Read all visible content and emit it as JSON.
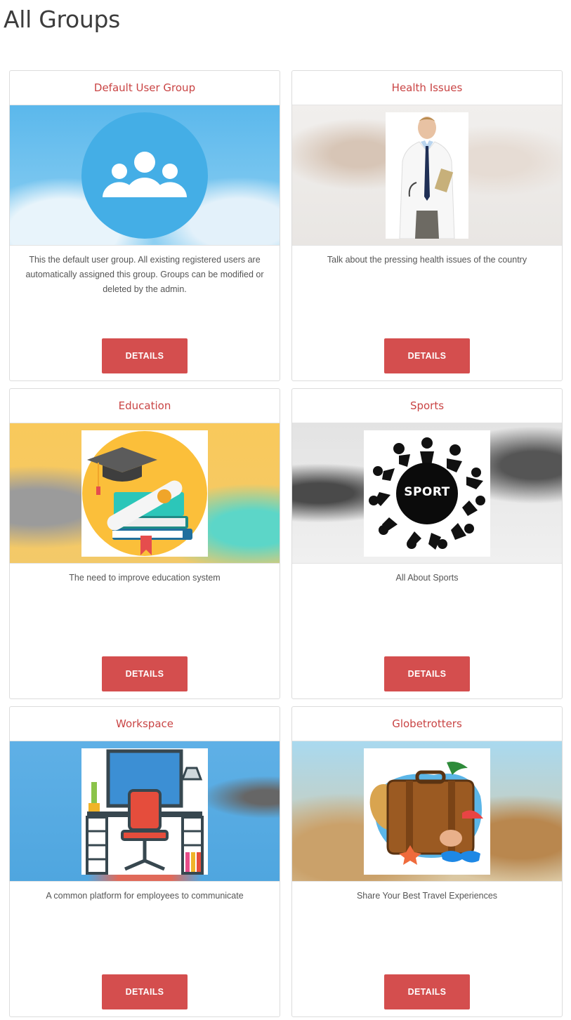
{
  "page": {
    "title": "All Groups",
    "accent_color": "#d44e4e",
    "title_color": "#c94444"
  },
  "groups": [
    {
      "name": "Default User Group",
      "description": "This the default user group. All existing registered users are automatically assigned this group. Groups can be modified or deleted by the admin.",
      "button_label": "DETAILS",
      "image_icon": "users-group-icon"
    },
    {
      "name": "Health Issues",
      "description": "Talk about the pressing health issues of the country",
      "button_label": "DETAILS",
      "image_icon": "doctor-photo"
    },
    {
      "name": "Education",
      "description": "The need to improve education system",
      "button_label": "DETAILS",
      "image_icon": "graduation-books-icon"
    },
    {
      "name": "Sports",
      "description": "All About Sports",
      "button_label": "DETAILS",
      "image_icon": "sport-silhouettes-icon",
      "image_text": "SPORT"
    },
    {
      "name": "Workspace",
      "description": "A common platform for employees to communicate",
      "button_label": "DETAILS",
      "image_icon": "office-desk-icon"
    },
    {
      "name": "Globetrotters",
      "description": "Share Your Best Travel Experiences",
      "button_label": "DETAILS",
      "image_icon": "travel-suitcase-icon"
    }
  ]
}
